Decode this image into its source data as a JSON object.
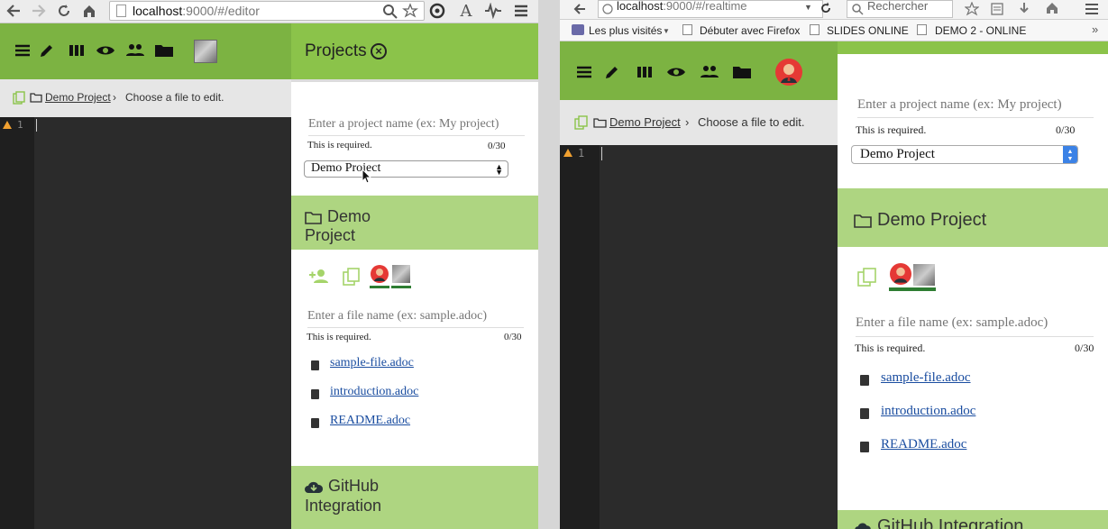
{
  "left": {
    "url_host": "localhost",
    "url_rest": ":9000/#/editor",
    "breadcrumb": {
      "project": "Demo Project",
      "separator": "›",
      "hint": "Choose a file to edit."
    },
    "editor": {
      "line_number": "1"
    },
    "projects_panel": {
      "title": "Projects",
      "project_name_placeholder": "Enter a project name (ex: My project)",
      "required_text": "This is required.",
      "counter": "0/30",
      "selected_project": "Demo Project"
    },
    "project_section": {
      "title_line1": "Demo",
      "title_line2": "Project",
      "file_name_placeholder": "Enter a file name (ex: sample.adoc)",
      "required_text": "This is required.",
      "counter": "0/30",
      "files": [
        "sample-file.adoc",
        "introduction.adoc",
        "README.adoc"
      ]
    },
    "github_section": {
      "title_line1": "GitHub",
      "title_line2": "Integration"
    }
  },
  "right": {
    "url_host": "localhost",
    "url_rest": ":9000/#/realtime",
    "search_placeholder": "Rechercher",
    "bookmarks": [
      "Les plus visités",
      "Débuter avec Firefox",
      "SLIDES ONLINE",
      "DEMO 2 - ONLINE"
    ],
    "breadcrumb": {
      "project": "Demo Project",
      "separator": "›",
      "hint": "Choose a file to edit."
    },
    "editor": {
      "line_number": "1"
    },
    "projects_panel": {
      "project_name_placeholder": "Enter a project name (ex: My project)",
      "required_text": "This is required.",
      "counter": "0/30",
      "selected_project": "Demo Project"
    },
    "project_section": {
      "title": "Demo Project",
      "file_name_placeholder": "Enter a file name (ex: sample.adoc)",
      "required_text": "This is required.",
      "counter": "0/30",
      "files": [
        "sample-file.adoc",
        "introduction.adoc",
        "README.adoc"
      ]
    },
    "github_section": {
      "title": "GitHub Integration"
    }
  },
  "colors": {
    "appbar": "#7cb342",
    "panel_head": "#8bc34a",
    "section_head": "#aed581",
    "editor_bg": "#2b2b2b",
    "link": "#1a4da0"
  },
  "icons": [
    "menu-icon",
    "pencil-icon",
    "columns-icon",
    "eye-icon",
    "people-icon",
    "folder-icon",
    "avatar-photo",
    "close-circle-icon",
    "add-user-icon",
    "copy-icon",
    "doc-icon",
    "cloud-download-icon"
  ]
}
